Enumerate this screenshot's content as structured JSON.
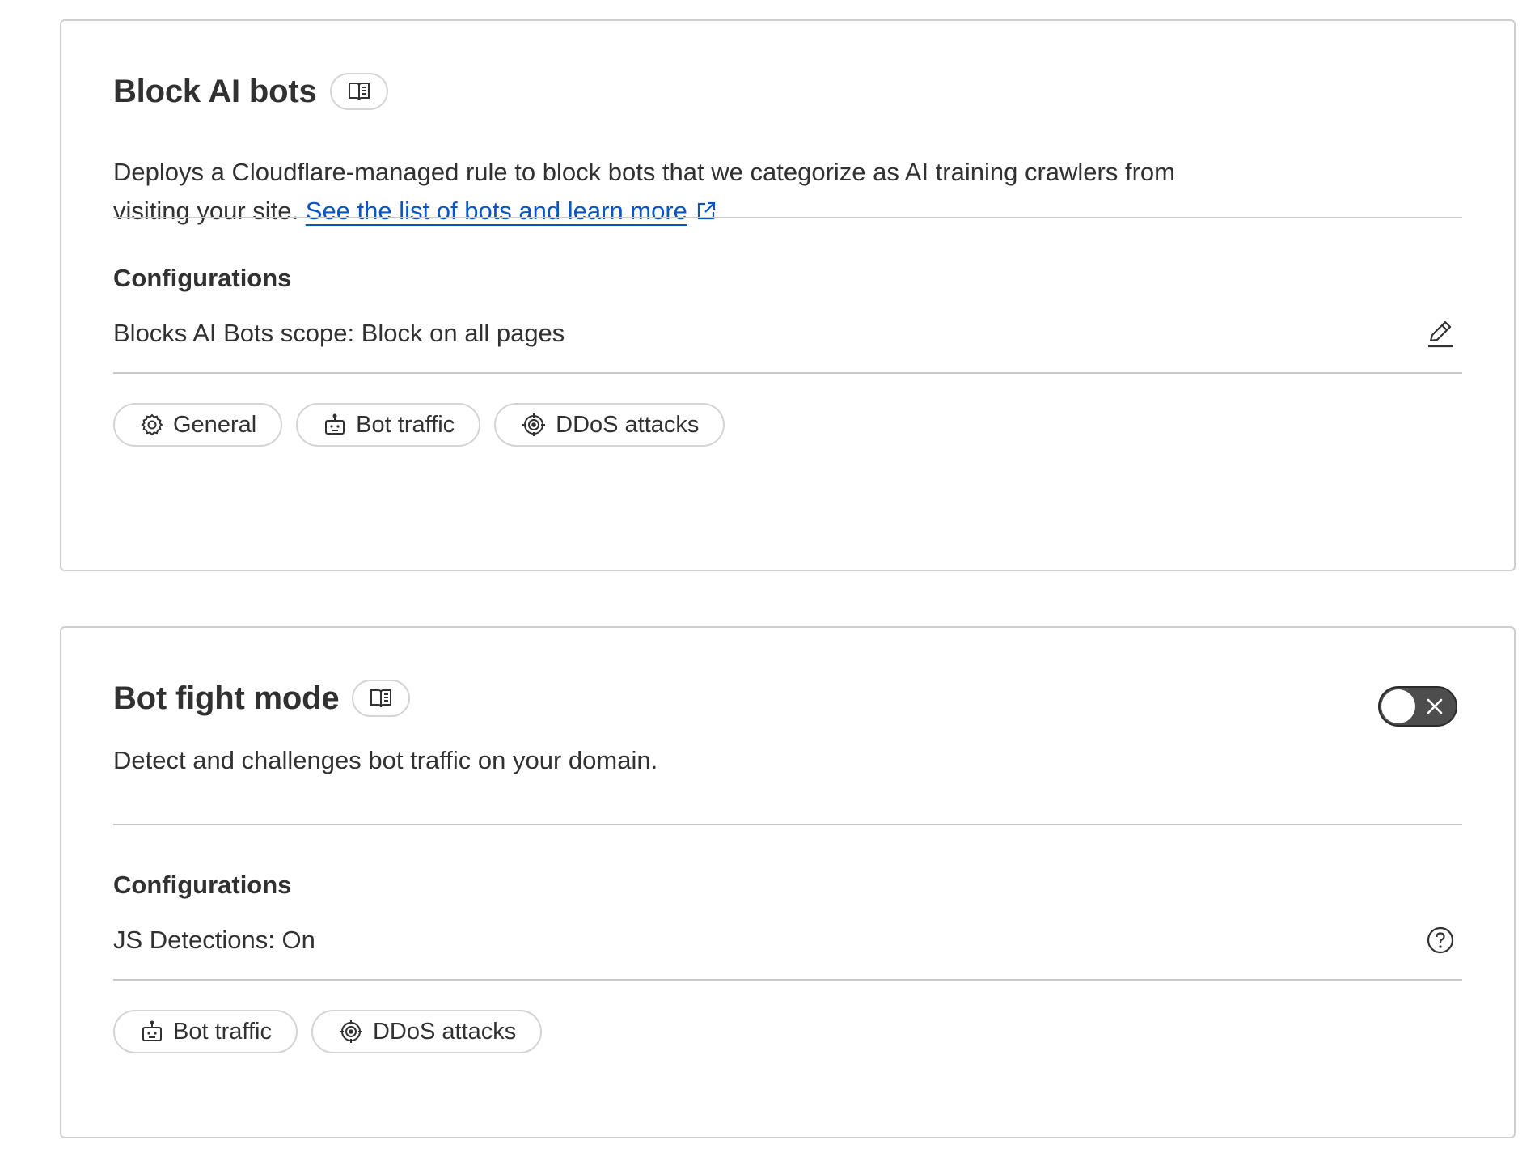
{
  "cards": [
    {
      "title": "Block AI bots",
      "description": "Deploys a Cloudflare-managed rule to block bots that we categorize as AI training crawlers from visiting your site.",
      "link_text": "See the list of bots and learn more",
      "configurations_title": "Configurations",
      "config_text": "Blocks AI Bots scope: Block on all pages",
      "config_icon": "pencil-icon",
      "tags": [
        {
          "label": "General",
          "icon": "gear-icon"
        },
        {
          "label": "Bot traffic",
          "icon": "robot-icon"
        },
        {
          "label": "DDoS attacks",
          "icon": "target-icon"
        }
      ]
    },
    {
      "title": "Bot fight mode",
      "description": "Detect and challenges bot traffic on your domain.",
      "toggle_state": "off",
      "configurations_title": "Configurations",
      "config_text": "JS Detections: On",
      "config_icon": "help-icon",
      "tags": [
        {
          "label": "Bot traffic",
          "icon": "robot-icon"
        },
        {
          "label": "DDoS attacks",
          "icon": "target-icon"
        }
      ]
    }
  ],
  "colors": {
    "link": "#0a55c5",
    "text": "#313131",
    "border": "#cfcfcf",
    "toggle_off": "#4d4d4d"
  }
}
